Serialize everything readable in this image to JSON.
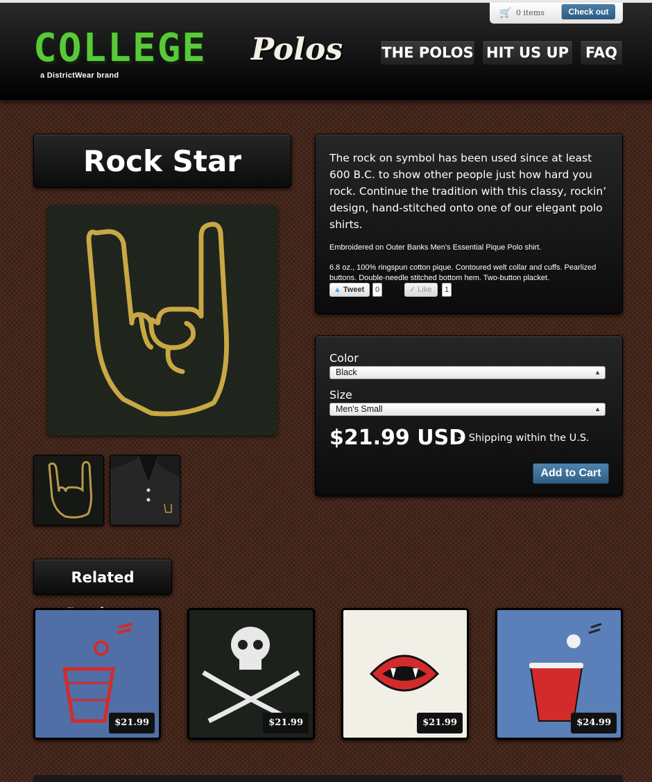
{
  "header": {
    "logo_main": "COLLEGE",
    "logo_script": "Polos",
    "tagline": "a DistrictWear brand",
    "cart_count": "0 items",
    "checkout_label": "Check out",
    "nav": [
      "THE POLOS",
      "HIT US UP",
      "FAQ"
    ]
  },
  "product": {
    "title": "Rock Star",
    "description": "The rock on symbol has been used since at least 600 B.C. to show other people just how hard you rock. Continue the tradition with this classy, rockin’ design, hand-stitched onto one of our elegant polo shirts.",
    "detail_1": "Embroidered on Outer Banks Men's Essential Pique Polo shirt.",
    "detail_2": "6.8 oz., 100% ringspun cotton pique. Contoured welt collar and cuffs. Pearlized buttons. Double-needle stitched bottom hem. Two-button placket.",
    "tweet_label": "Tweet",
    "tweet_count": "0",
    "like_label": "Like",
    "like_count": "1",
    "color_label": "Color",
    "color_value": "Black",
    "size_label": "Size",
    "size_value": "Men's Small",
    "price": "$21.99 USD",
    "shipping": "+ Shipping within the U.S.",
    "add_to_cart": "Add to Cart"
  },
  "related": {
    "heading": "Related Products",
    "items": [
      {
        "price": "$21.99",
        "bg": "#4f6fa6"
      },
      {
        "price": "$21.99",
        "bg": "#1c211c"
      },
      {
        "price": "$21.99",
        "bg": "#f1efe6"
      },
      {
        "price": "$24.99",
        "bg": "#5b7fb8"
      }
    ]
  },
  "colors": {
    "logo_green": "#59c93a",
    "button_blue": "#3a6b93",
    "embroidery_gold": "#c9a844",
    "cup_red": "#d32b2b"
  }
}
